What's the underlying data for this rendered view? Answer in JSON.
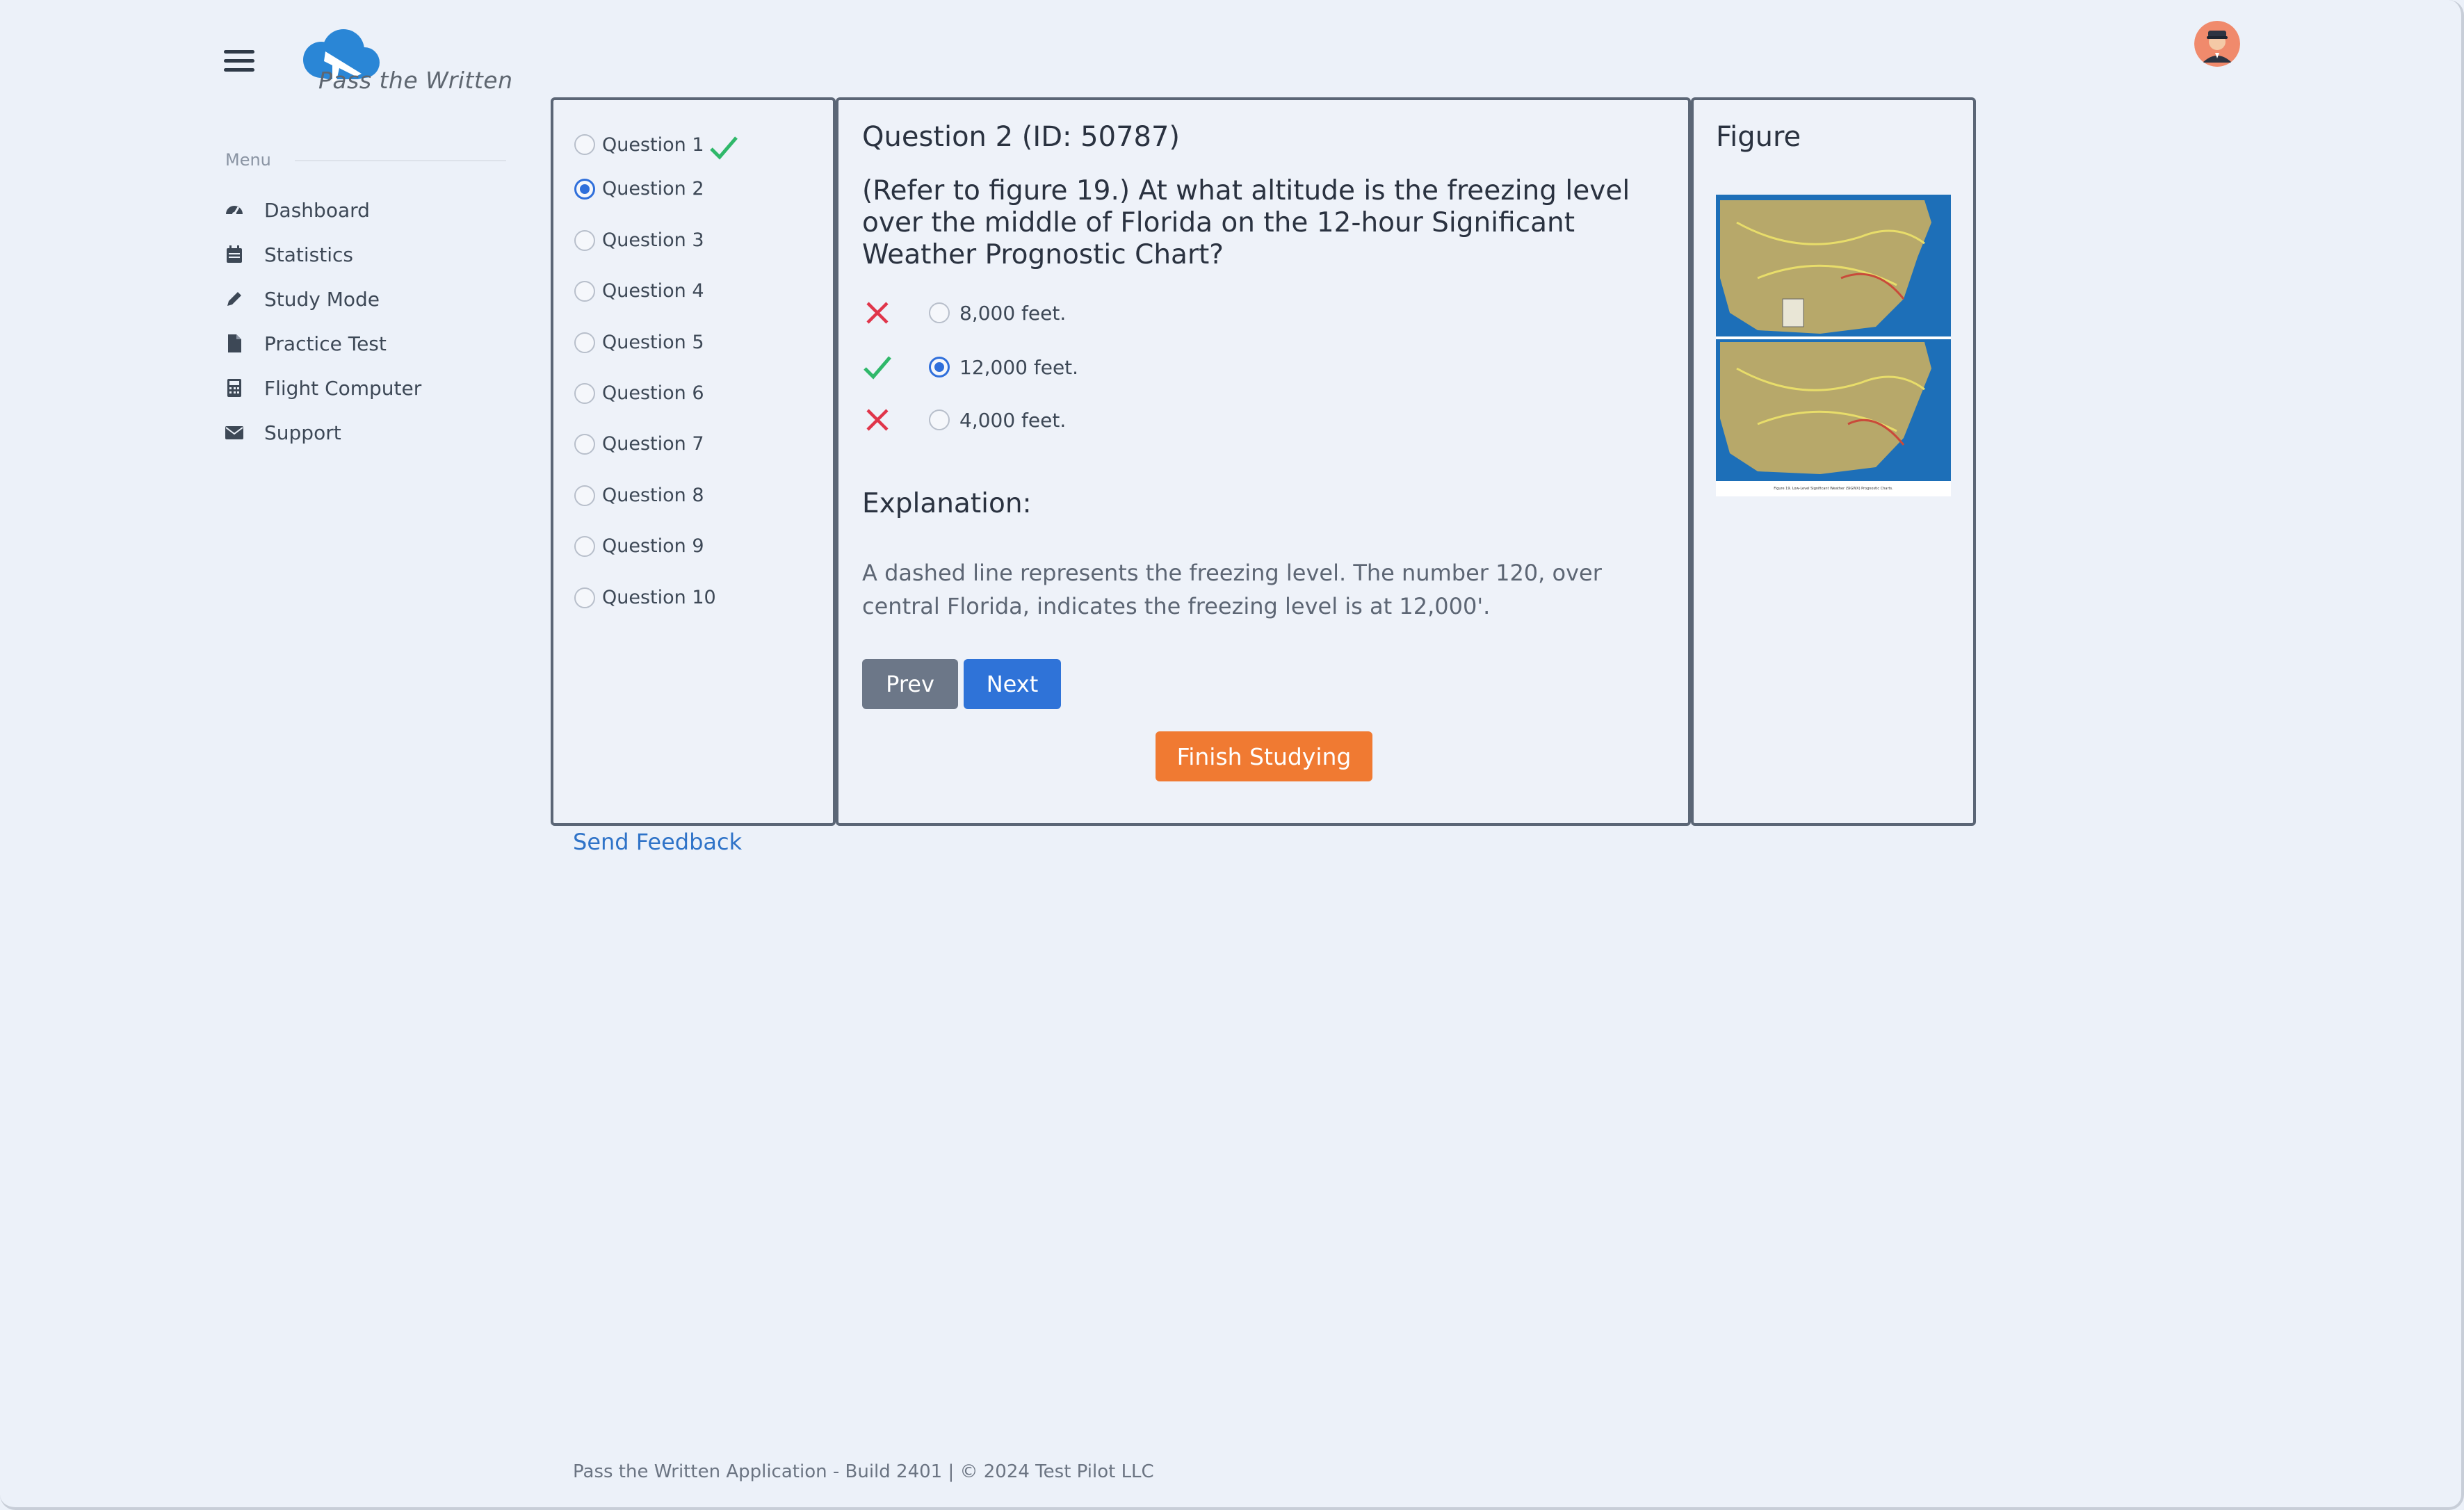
{
  "app": {
    "logo_text": "Pass the Written",
    "accent_color": "#2f73d8"
  },
  "sidebar": {
    "heading": "Menu",
    "items": [
      {
        "label": "Dashboard",
        "icon": "speedometer-icon"
      },
      {
        "label": "Statistics",
        "icon": "calendar-icon"
      },
      {
        "label": "Study Mode",
        "icon": "pencil-icon"
      },
      {
        "label": "Practice Test",
        "icon": "file-icon"
      },
      {
        "label": "Flight Computer",
        "icon": "calculator-icon"
      },
      {
        "label": "Support",
        "icon": "envelope-icon"
      }
    ]
  },
  "question_list": [
    {
      "label": "Question 1",
      "selected": false,
      "status": "correct"
    },
    {
      "label": "Question 2",
      "selected": true,
      "status": ""
    },
    {
      "label": "Question 3",
      "selected": false,
      "status": ""
    },
    {
      "label": "Question 4",
      "selected": false,
      "status": ""
    },
    {
      "label": "Question 5",
      "selected": false,
      "status": ""
    },
    {
      "label": "Question 6",
      "selected": false,
      "status": ""
    },
    {
      "label": "Question 7",
      "selected": false,
      "status": ""
    },
    {
      "label": "Question 8",
      "selected": false,
      "status": ""
    },
    {
      "label": "Question 9",
      "selected": false,
      "status": ""
    },
    {
      "label": "Question 10",
      "selected": false,
      "status": ""
    }
  ],
  "question": {
    "title": "Question 2 (ID: 50787)",
    "text": "(Refer to figure 19.) At what altitude is the freezing level over the middle of Florida on the 12-hour Significant Weather Prognostic Chart?",
    "answers": [
      {
        "label": "8,000 feet.",
        "result": "incorrect",
        "selected": false
      },
      {
        "label": "12,000 feet.",
        "result": "correct",
        "selected": true
      },
      {
        "label": "4,000 feet.",
        "result": "incorrect",
        "selected": false
      }
    ],
    "explanation_title": "Explanation:",
    "explanation": "A dashed line represents the freezing level. The number 120, over central Florida, indicates the freezing level is at 12,000'.",
    "prev_label": "Prev",
    "next_label": "Next",
    "finish_label": "Finish Studying"
  },
  "figure": {
    "title": "Figure",
    "caption": "Figure 19. Low-Level Significant Weather (SIGWX) Prognostic Charts."
  },
  "feedback_link": "Send Feedback",
  "footer": "Pass the Written Application - Build 2401 | © 2024 Test Pilot LLC",
  "colors": {
    "correct": "#2fb86a",
    "incorrect": "#e0354a",
    "finish_button": "#f07a32",
    "prev_button": "#6c7788"
  }
}
